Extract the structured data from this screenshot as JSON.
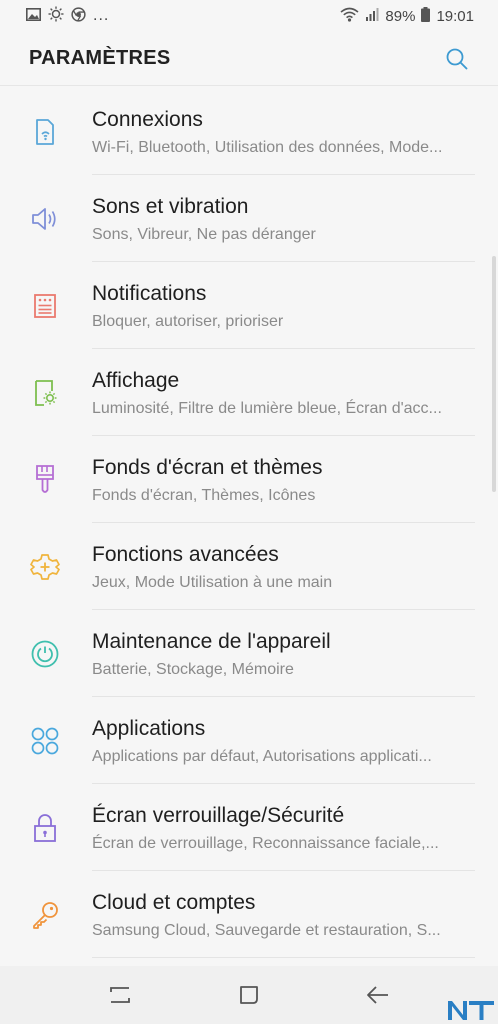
{
  "status_bar": {
    "battery": "89%",
    "time": "19:01",
    "overflow": "...",
    "icons": [
      "image-icon",
      "sun-icon",
      "chrome-icon",
      "wifi-icon",
      "signal-icon",
      "battery-icon"
    ]
  },
  "header": {
    "title": "PARAMÈTRES",
    "search_icon": "search-icon",
    "accent": "#3d9ad1"
  },
  "settings": [
    {
      "id": "connexions",
      "icon": "phone-wifi-icon",
      "color": "#5aa7d8",
      "title": "Connexions",
      "subtitle": "Wi-Fi, Bluetooth, Utilisation des données, Mode..."
    },
    {
      "id": "sons",
      "icon": "speaker-icon",
      "color": "#7f8fd8",
      "title": "Sons et vibration",
      "subtitle": "Sons, Vibreur, Ne pas déranger"
    },
    {
      "id": "notifications",
      "icon": "notification-panel-icon",
      "color": "#ea7a6e",
      "title": "Notifications",
      "subtitle": "Bloquer, autoriser, prioriser"
    },
    {
      "id": "affichage",
      "icon": "display-brightness-icon",
      "color": "#7ebf4f",
      "title": "Affichage",
      "subtitle": "Luminosité, Filtre de lumière bleue, Écran d'acc..."
    },
    {
      "id": "fonds",
      "icon": "paintbrush-icon",
      "color": "#b56ed4",
      "title": "Fonds d'écran et thèmes",
      "subtitle": "Fonds d'écran, Thèmes, Icônes"
    },
    {
      "id": "fonctions",
      "icon": "gear-plus-icon",
      "color": "#f0b43c",
      "title": "Fonctions avancées",
      "subtitle": "Jeux, Mode Utilisation à une main"
    },
    {
      "id": "maintenance",
      "icon": "device-care-icon",
      "color": "#3fbfae",
      "title": "Maintenance de l'appareil",
      "subtitle": "Batterie, Stockage, Mémoire"
    },
    {
      "id": "applications",
      "icon": "apps-grid-icon",
      "color": "#4aa8dd",
      "title": "Applications",
      "subtitle": "Applications par défaut, Autorisations applicati..."
    },
    {
      "id": "ecran-verrouillage",
      "icon": "lock-icon",
      "color": "#8a6fd8",
      "title": "Écran verrouillage/Sécurité",
      "subtitle": "Écran de verrouillage, Reconnaissance faciale,..."
    },
    {
      "id": "cloud",
      "icon": "key-icon",
      "color": "#f0943c",
      "title": "Cloud et comptes",
      "subtitle": "Samsung Cloud, Sauvegarde et restauration, S..."
    }
  ],
  "nav_bar": {
    "icons": [
      "recents-icon",
      "home-icon",
      "back-icon"
    ]
  },
  "watermark": {
    "text": "NT",
    "color": "#2a7fc4"
  }
}
